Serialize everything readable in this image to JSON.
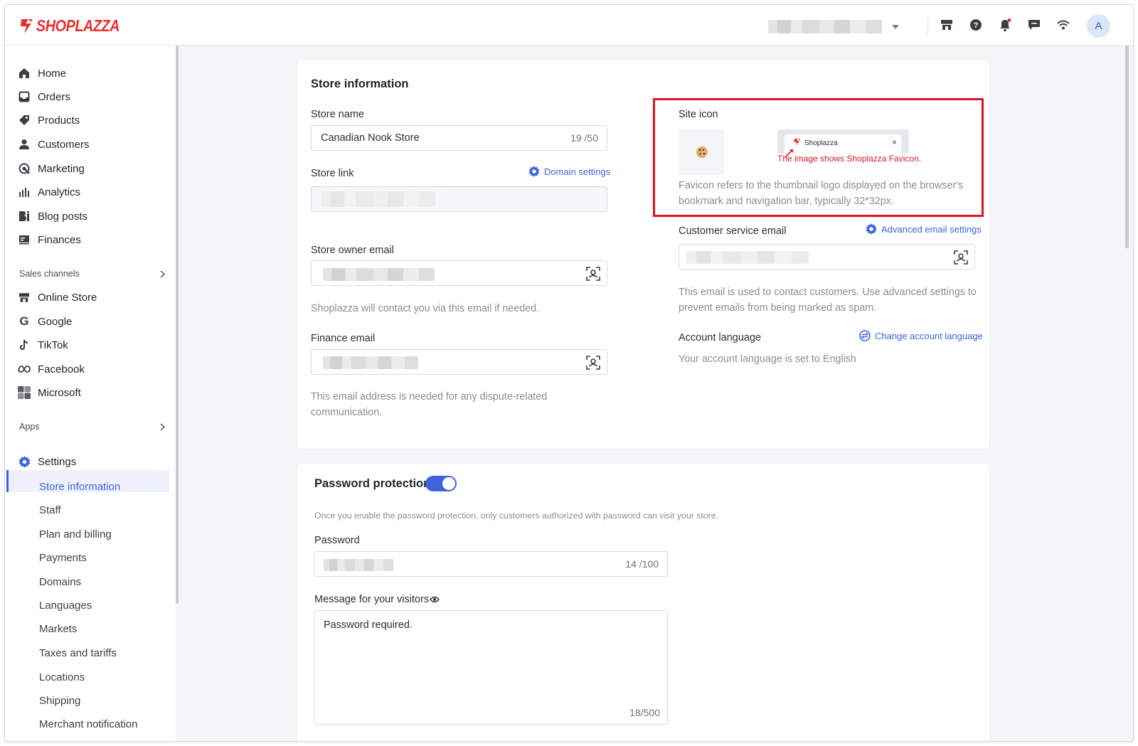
{
  "app": {
    "logo_text": "SHOPLAZZA",
    "avatar_initial": "A",
    "brand_color": "#e8302f",
    "accent_color": "#3f63dd"
  },
  "topbar": {
    "icons": [
      "store-icon",
      "help-icon",
      "bell-icon",
      "chat-icon",
      "wifi-icon"
    ]
  },
  "sidebar": {
    "main_items": [
      {
        "label": "Home",
        "icon": "home-icon"
      },
      {
        "label": "Orders",
        "icon": "orders-icon"
      },
      {
        "label": "Products",
        "icon": "tag-icon"
      },
      {
        "label": "Customers",
        "icon": "person-icon"
      },
      {
        "label": "Marketing",
        "icon": "marketing-icon"
      },
      {
        "label": "Analytics",
        "icon": "bar-chart-icon"
      },
      {
        "label": "Blog posts",
        "icon": "blog-icon"
      },
      {
        "label": "Finances",
        "icon": "finance-icon"
      }
    ],
    "sales_channels_label": "Sales channels",
    "channels": [
      {
        "label": "Online Store",
        "icon": "store-icon"
      },
      {
        "label": "Google",
        "icon": "google-icon"
      },
      {
        "label": "TikTok",
        "icon": "tiktok-icon"
      },
      {
        "label": "Facebook",
        "icon": "meta-icon"
      },
      {
        "label": "Microsoft",
        "icon": "microsoft-icon"
      }
    ],
    "apps_label": "Apps",
    "settings_label": "Settings",
    "settings_items": [
      "Store information",
      "Staff",
      "Plan and billing",
      "Payments",
      "Domains",
      "Languages",
      "Markets",
      "Taxes and tariffs",
      "Locations",
      "Shipping",
      "Merchant notification"
    ],
    "active_item": "Store information"
  },
  "store_info": {
    "title": "Store information",
    "store_name_label": "Store name",
    "store_name_value": "Canadian Nook Store",
    "store_name_count": "19 /50",
    "store_link_label": "Store link",
    "domain_settings_link": "Domain settings",
    "owner_email_label": "Store owner email",
    "owner_email_help": "Shoplazza will contact you via this email if needed.",
    "finance_email_label": "Finance email",
    "finance_email_help": "This email address is needed for any dispute-related communication.",
    "site_icon_label": "Site icon",
    "tab_preview_text": "Shoplazza",
    "tab_close": "×",
    "annotation": "The image shows Shoplazza Favicon.",
    "favicon_help": "Favicon refers to the thumbnail logo displayed on the browser's bookmark and navigation bar, typically 32*32px.",
    "cs_email_label": "Customer service email",
    "advanced_email_link": "Advanced email settings",
    "cs_email_help": "This email is used to contact customers. Use advanced settings to prevent emails from being marked as spam.",
    "account_language_label": "Account language",
    "change_language_link": "Change account language",
    "account_language_text": "Your account language is set to English"
  },
  "password": {
    "title": "Password protection",
    "enabled": true,
    "description": "Once you enable the password protection, only customers authorized with password can visit your store.",
    "password_label": "Password",
    "password_count": "14 /100",
    "message_label": "Message for your visitors",
    "message_value": "Password required.",
    "message_count": "18/500"
  }
}
